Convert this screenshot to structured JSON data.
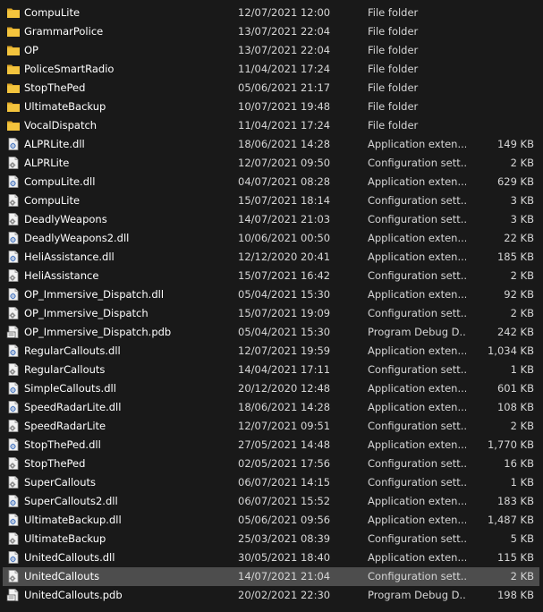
{
  "colors": {
    "background": "#191919",
    "selected_row": "#4d4d4d",
    "folder": "#f3c43d",
    "text": "#ffffff",
    "secondary_text": "#d6d6d6"
  },
  "files": [
    {
      "name": "CompuLite",
      "date": "12/07/2021 12:00",
      "type": "File folder",
      "size": "",
      "icon": "folder-icon"
    },
    {
      "name": "GrammarPolice",
      "date": "13/07/2021 22:04",
      "type": "File folder",
      "size": "",
      "icon": "folder-icon"
    },
    {
      "name": "OP",
      "date": "13/07/2021 22:04",
      "type": "File folder",
      "size": "",
      "icon": "folder-icon"
    },
    {
      "name": "PoliceSmartRadio",
      "date": "11/04/2021 17:24",
      "type": "File folder",
      "size": "",
      "icon": "folder-icon"
    },
    {
      "name": "StopThePed",
      "date": "05/06/2021 21:17",
      "type": "File folder",
      "size": "",
      "icon": "folder-icon"
    },
    {
      "name": "UltimateBackup",
      "date": "10/07/2021 19:48",
      "type": "File folder",
      "size": "",
      "icon": "folder-icon"
    },
    {
      "name": "VocalDispatch",
      "date": "11/04/2021 17:24",
      "type": "File folder",
      "size": "",
      "icon": "folder-icon"
    },
    {
      "name": "ALPRLite.dll",
      "date": "18/06/2021 14:28",
      "type": "Application exten...",
      "size": "149 KB",
      "icon": "dll-file-icon"
    },
    {
      "name": "ALPRLite",
      "date": "12/07/2021 09:50",
      "type": "Configuration sett...",
      "size": "2 KB",
      "icon": "config-file-icon"
    },
    {
      "name": "CompuLite.dll",
      "date": "04/07/2021 08:28",
      "type": "Application exten...",
      "size": "629 KB",
      "icon": "dll-file-icon"
    },
    {
      "name": "CompuLite",
      "date": "15/07/2021 18:14",
      "type": "Configuration sett...",
      "size": "3 KB",
      "icon": "config-file-icon"
    },
    {
      "name": "DeadlyWeapons",
      "date": "14/07/2021 21:03",
      "type": "Configuration sett...",
      "size": "3 KB",
      "icon": "config-file-icon"
    },
    {
      "name": "DeadlyWeapons2.dll",
      "date": "10/06/2021 00:50",
      "type": "Application exten...",
      "size": "22 KB",
      "icon": "dll-file-icon"
    },
    {
      "name": "HeliAssistance.dll",
      "date": "12/12/2020 20:41",
      "type": "Application exten...",
      "size": "185 KB",
      "icon": "dll-file-icon"
    },
    {
      "name": "HeliAssistance",
      "date": "15/07/2021 16:42",
      "type": "Configuration sett...",
      "size": "2 KB",
      "icon": "config-file-icon"
    },
    {
      "name": "OP_Immersive_Dispatch.dll",
      "date": "05/04/2021 15:30",
      "type": "Application exten...",
      "size": "92 KB",
      "icon": "dll-file-icon"
    },
    {
      "name": "OP_Immersive_Dispatch",
      "date": "15/07/2021 19:09",
      "type": "Configuration sett...",
      "size": "2 KB",
      "icon": "config-file-icon"
    },
    {
      "name": "OP_Immersive_Dispatch.pdb",
      "date": "05/04/2021 15:30",
      "type": "Program Debug D...",
      "size": "242 KB",
      "icon": "pdb-file-icon"
    },
    {
      "name": "RegularCallouts.dll",
      "date": "12/07/2021 19:59",
      "type": "Application exten...",
      "size": "1,034 KB",
      "icon": "dll-file-icon"
    },
    {
      "name": "RegularCallouts",
      "date": "14/04/2021 17:11",
      "type": "Configuration sett...",
      "size": "1 KB",
      "icon": "config-file-icon"
    },
    {
      "name": "SimpleCallouts.dll",
      "date": "20/12/2020 12:48",
      "type": "Application exten...",
      "size": "601 KB",
      "icon": "dll-file-icon"
    },
    {
      "name": "SpeedRadarLite.dll",
      "date": "18/06/2021 14:28",
      "type": "Application exten...",
      "size": "108 KB",
      "icon": "dll-file-icon"
    },
    {
      "name": "SpeedRadarLite",
      "date": "12/07/2021 09:51",
      "type": "Configuration sett...",
      "size": "2 KB",
      "icon": "config-file-icon"
    },
    {
      "name": "StopThePed.dll",
      "date": "27/05/2021 14:48",
      "type": "Application exten...",
      "size": "1,770 KB",
      "icon": "dll-file-icon"
    },
    {
      "name": "StopThePed",
      "date": "02/05/2021 17:56",
      "type": "Configuration sett...",
      "size": "16 KB",
      "icon": "config-file-icon"
    },
    {
      "name": "SuperCallouts",
      "date": "06/07/2021 14:15",
      "type": "Configuration sett...",
      "size": "1 KB",
      "icon": "config-file-icon"
    },
    {
      "name": "SuperCallouts2.dll",
      "date": "06/07/2021 15:52",
      "type": "Application exten...",
      "size": "183 KB",
      "icon": "dll-file-icon"
    },
    {
      "name": "UltimateBackup.dll",
      "date": "05/06/2021 09:56",
      "type": "Application exten...",
      "size": "1,487 KB",
      "icon": "dll-file-icon"
    },
    {
      "name": "UltimateBackup",
      "date": "25/03/2021 08:39",
      "type": "Configuration sett...",
      "size": "5 KB",
      "icon": "config-file-icon"
    },
    {
      "name": "UnitedCallouts.dll",
      "date": "30/05/2021 18:40",
      "type": "Application exten...",
      "size": "115 KB",
      "icon": "dll-file-icon"
    },
    {
      "name": "UnitedCallouts",
      "date": "14/07/2021 21:04",
      "type": "Configuration sett...",
      "size": "2 KB",
      "icon": "config-file-icon",
      "selected": true
    },
    {
      "name": "UnitedCallouts.pdb",
      "date": "20/02/2021 22:30",
      "type": "Program Debug D...",
      "size": "198 KB",
      "icon": "pdb-file-icon"
    }
  ]
}
